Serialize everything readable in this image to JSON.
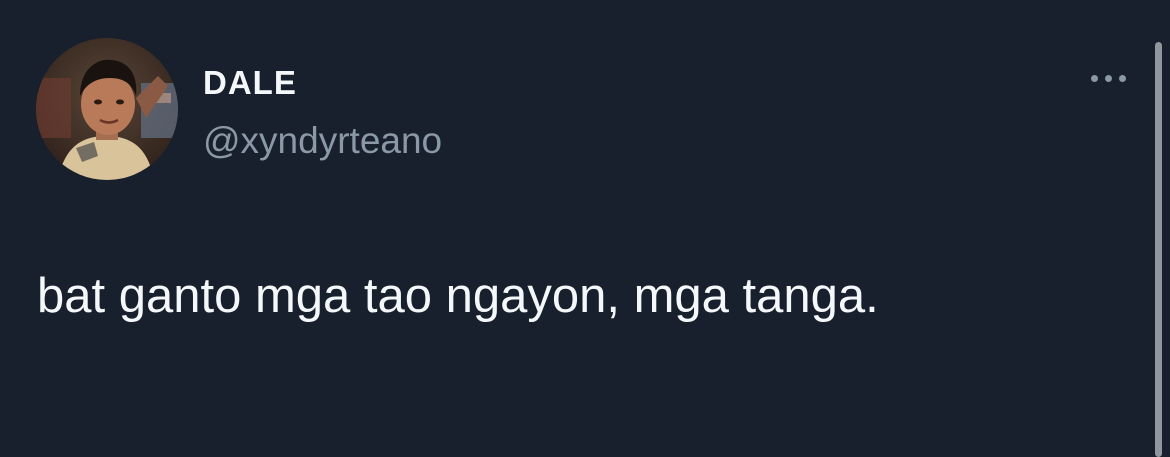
{
  "tweet": {
    "display_name": "DALE",
    "handle": "@xyndyrteano",
    "text": "bat ganto mga tao ngayon, mga tanga.",
    "avatar_icon": "profile-photo",
    "more_icon": "ellipsis-icon"
  },
  "colors": {
    "background": "#17202c",
    "primary_text": "#f5f8fa",
    "secondary_text": "#8b98a5",
    "scrollbar": "#8f969d"
  }
}
